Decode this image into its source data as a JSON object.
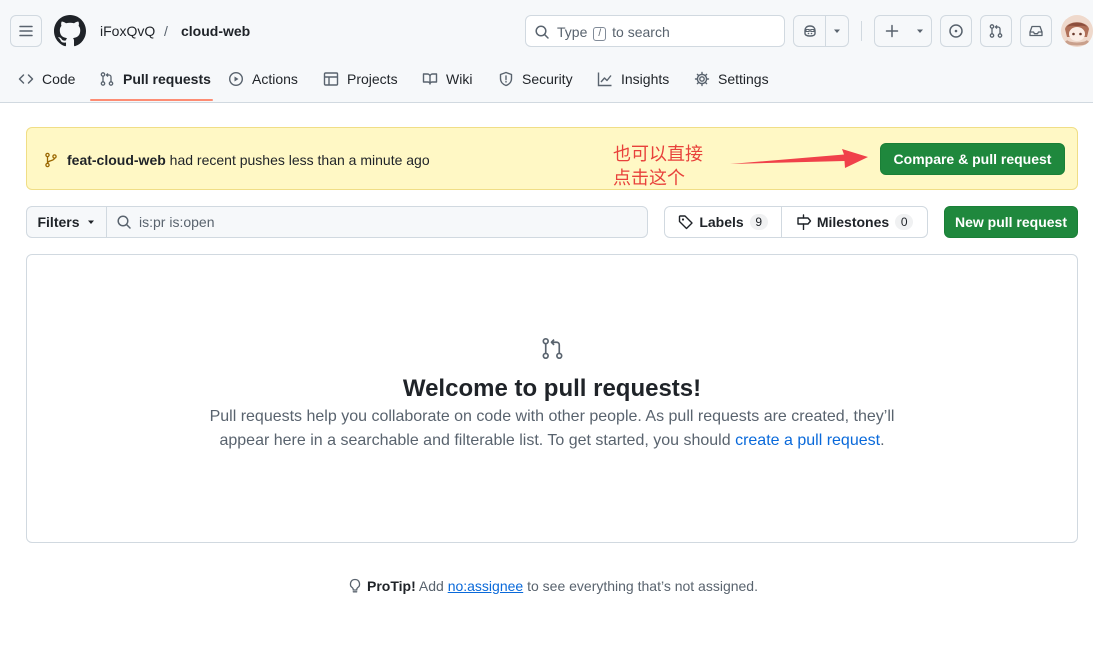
{
  "header": {
    "owner": "iFoxQvQ",
    "separator": "/",
    "repo": "cloud-web",
    "search": {
      "label_before": "Type",
      "key": "/",
      "label_after": "to search"
    }
  },
  "tabs": [
    {
      "label": "Code",
      "icon": "code-icon"
    },
    {
      "label": "Pull requests",
      "icon": "git-pull-request-icon",
      "active": true
    },
    {
      "label": "Actions",
      "icon": "play-icon"
    },
    {
      "label": "Projects",
      "icon": "table-icon"
    },
    {
      "label": "Wiki",
      "icon": "book-icon"
    },
    {
      "label": "Security",
      "icon": "shield-icon"
    },
    {
      "label": "Insights",
      "icon": "graph-icon"
    },
    {
      "label": "Settings",
      "icon": "gear-icon"
    }
  ],
  "flash": {
    "branch": "feat-cloud-web",
    "message": "had recent pushes less than a minute ago",
    "button": "Compare & pull request",
    "annotation_line1": "也可以直接",
    "annotation_line2": "点击这个"
  },
  "filters": {
    "button": "Filters",
    "query": "is:pr is:open",
    "labels": {
      "label": "Labels",
      "count": "9"
    },
    "milestones": {
      "label": "Milestones",
      "count": "0"
    },
    "new_pr": "New pull request"
  },
  "blank_state": {
    "title": "Welcome to pull requests!",
    "text": "Pull requests help you collaborate on code with other people. As pull requests are created, they’ll appear here in a searchable and filterable list. To get started, you should",
    "link": "create a pull request",
    "period": "."
  },
  "protip": {
    "label": "ProTip!",
    "before": "Add",
    "link": "no:assignee",
    "after": "to see everything that’s not assigned."
  },
  "colors": {
    "primary_button": "#1f883d",
    "flash_background": "#fff8c5",
    "annotation": "#e8413b",
    "link": "#0969da",
    "tab_underline": "#fd8c73"
  }
}
